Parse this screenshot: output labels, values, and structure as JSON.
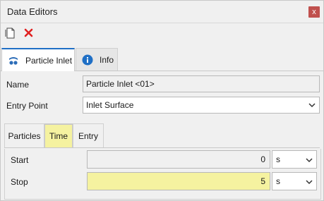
{
  "window": {
    "title": "Data Editors",
    "close_label": "x"
  },
  "toolbar": {
    "new_icon": "new-document-icon",
    "delete_icon": "delete-x-icon",
    "delete_color": "#e02020"
  },
  "outer_tabs": [
    {
      "label": "Particle Inlet",
      "icon": "particle-inlet-icon",
      "active": true
    },
    {
      "label": "Info",
      "icon": "info-icon",
      "active": false
    }
  ],
  "fields": {
    "name": {
      "label": "Name",
      "value": "Particle Inlet <01>"
    },
    "entry_point": {
      "label": "Entry Point",
      "value": "Inlet Surface"
    }
  },
  "inner_tabs": [
    {
      "label": "Particles",
      "active": false
    },
    {
      "label": "Time",
      "active": true
    },
    {
      "label": "Entry",
      "active": false
    }
  ],
  "time": {
    "start": {
      "label": "Start",
      "value": "0",
      "unit": "s"
    },
    "stop": {
      "label": "Stop",
      "value": "5",
      "unit": "s"
    }
  },
  "colors": {
    "accent": "#1f6fc5",
    "highlight": "#f5f2a0",
    "close_bg": "#c0504d"
  }
}
